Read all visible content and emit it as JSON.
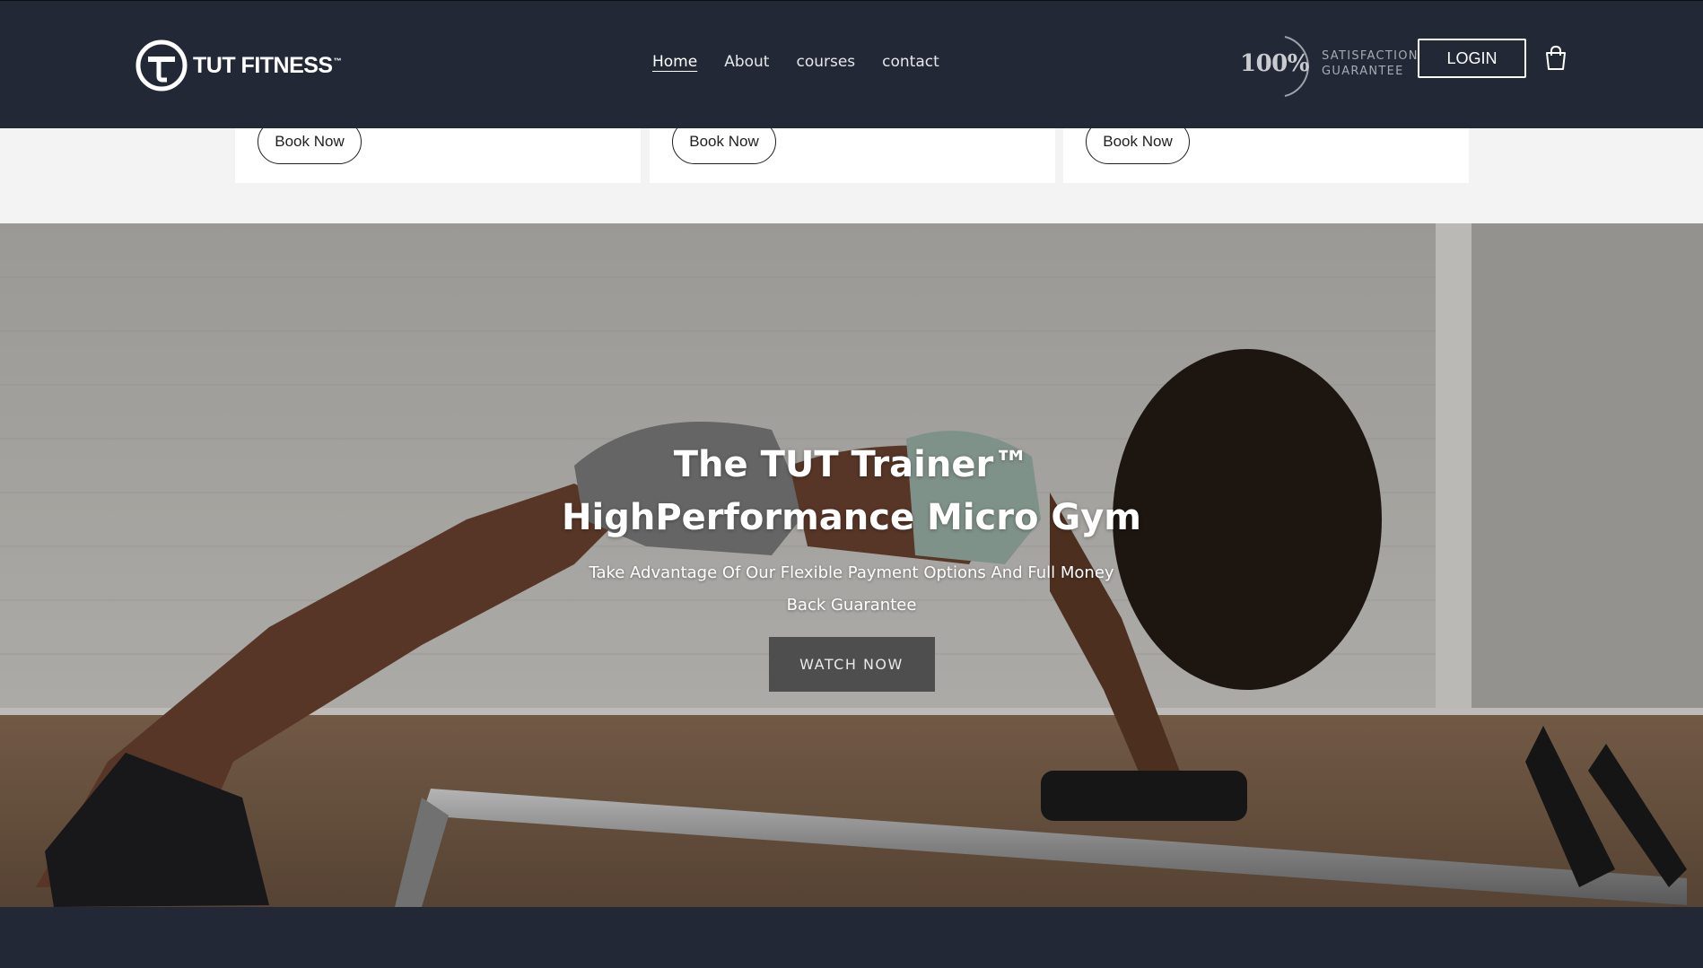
{
  "header": {
    "logo_text": "TUT FITNESS",
    "logo_tm": "™",
    "nav": [
      {
        "label": "Home",
        "active": true
      },
      {
        "label": "About",
        "active": false
      },
      {
        "label": "courses",
        "active": false
      },
      {
        "label": "contact",
        "active": false
      }
    ],
    "guarantee": {
      "percent": "100%",
      "line1": "SATISFACTION",
      "line2": "GUARANTEE"
    },
    "login_label": "LOGIN"
  },
  "product_strip": {
    "cards": [
      {
        "button_label": "Book Now"
      },
      {
        "button_label": "Book Now"
      },
      {
        "button_label": "Book Now"
      }
    ]
  },
  "hero": {
    "title_line1": "The TUT Trainer™",
    "title_line2": "HighPerformance Micro Gym",
    "subtitle": "Take Advantage Of Our Flexible Payment Options And Full Money Back Guarantee",
    "button_label": "WATCH NOW"
  },
  "colors": {
    "header_bg": "#232837",
    "page_bg": "#f3f3f3",
    "button_dark": "#464646"
  }
}
